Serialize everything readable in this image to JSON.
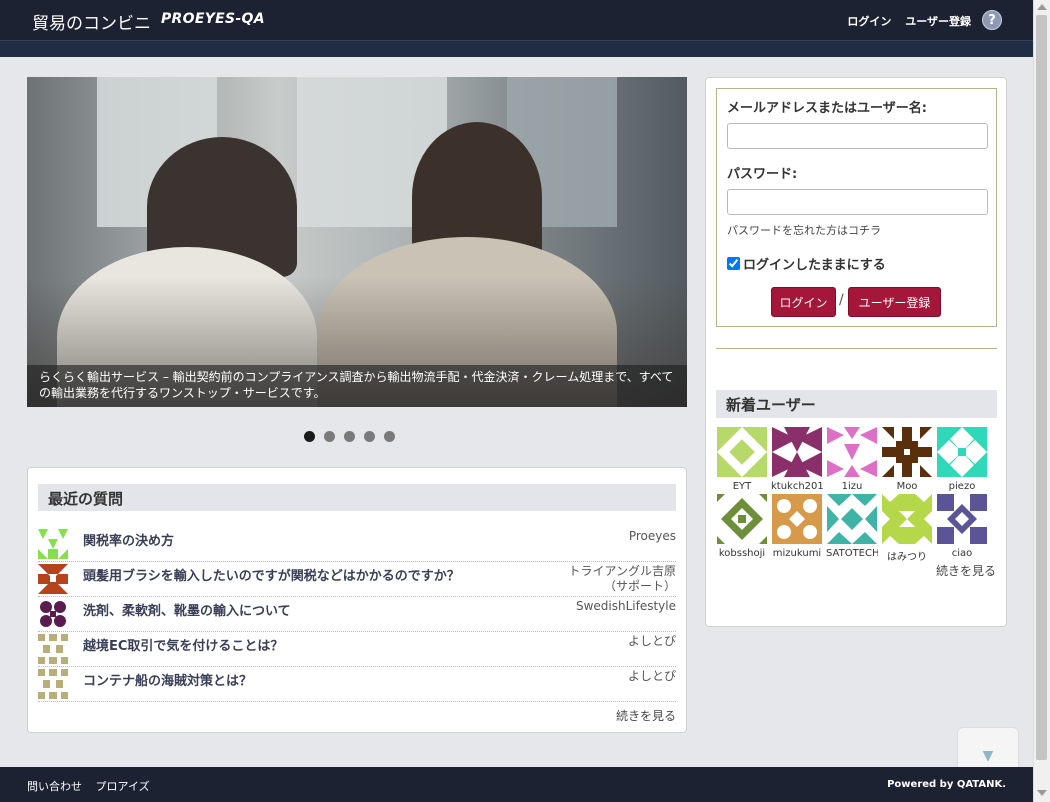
{
  "header": {
    "brand": "貿易のコンビニ",
    "brand_sub": "PROEYES-QA",
    "login": "ログイン",
    "register": "ユーザー登録",
    "help": "?"
  },
  "hero": {
    "caption": "らくらく輸出サービス – 輸出契約前のコンプライアンス調査から輸出物流手配・代金決済・クレーム処理まで、すべての輸出業務を代行するワンストップ・サービスです。",
    "slide_count": 5,
    "active_slide": 1
  },
  "questions": {
    "title": "最近の質問",
    "items": [
      {
        "title": "関税率の決め方",
        "user": "Proeyes",
        "icon_color": "#86e04a"
      },
      {
        "title": "頭髪用ブラシを輸入したいのですが関税などはかかるのですか？",
        "user": "トライアングル吉原（サポート）",
        "icon_color": "#b5431c"
      },
      {
        "title": "洗剤、柔軟剤、靴墨の輸入について",
        "user": "SwedishLifestyle",
        "icon_color": "#5a1c4e"
      },
      {
        "title": "越境EC取引で気を付けることは？",
        "user": "よしとぴ",
        "icon_color": "#b8ae7a"
      },
      {
        "title": "コンテナ船の海賊対策とは？",
        "user": "よしとぴ",
        "icon_color": "#b8ae7a"
      }
    ],
    "more": "続きを見る"
  },
  "login": {
    "user_label": "メールアドレスまたはユーザー名:",
    "user_value": "",
    "password_label": "パスワード:",
    "password_value": "",
    "forgot": "パスワードを忘れた方はコチラ",
    "remember": "ログインしたままにする",
    "remember_checked": true,
    "login_button": "ログイン",
    "separator": "/",
    "register_button": "ユーザー登録"
  },
  "new_users": {
    "title": "新着ユーザー",
    "users": [
      {
        "name": "EYT",
        "color": "#b7d96a"
      },
      {
        "name": "ktukch201",
        "color": "#8a2f6a"
      },
      {
        "name": "1izu",
        "color": "#de6fc7"
      },
      {
        "name": "Moo",
        "color": "#5a2f0c"
      },
      {
        "name": "piezo",
        "color": "#2fd8b8"
      },
      {
        "name": "kobsshoji",
        "color": "#6e8f3a"
      },
      {
        "name": "mizukumi",
        "color": "#d69a4a"
      },
      {
        "name": "SATOTECH",
        "color": "#3fb4a6"
      },
      {
        "name": "はみつり",
        "color": "#b5d84a"
      },
      {
        "name": "ciao",
        "color": "#5b5598"
      }
    ],
    "more": "続きを見る"
  },
  "footer": {
    "contact": "問い合わせ",
    "proeyes": "プロアイズ",
    "powered": "Powered by QATANK."
  },
  "to_top": "▼"
}
